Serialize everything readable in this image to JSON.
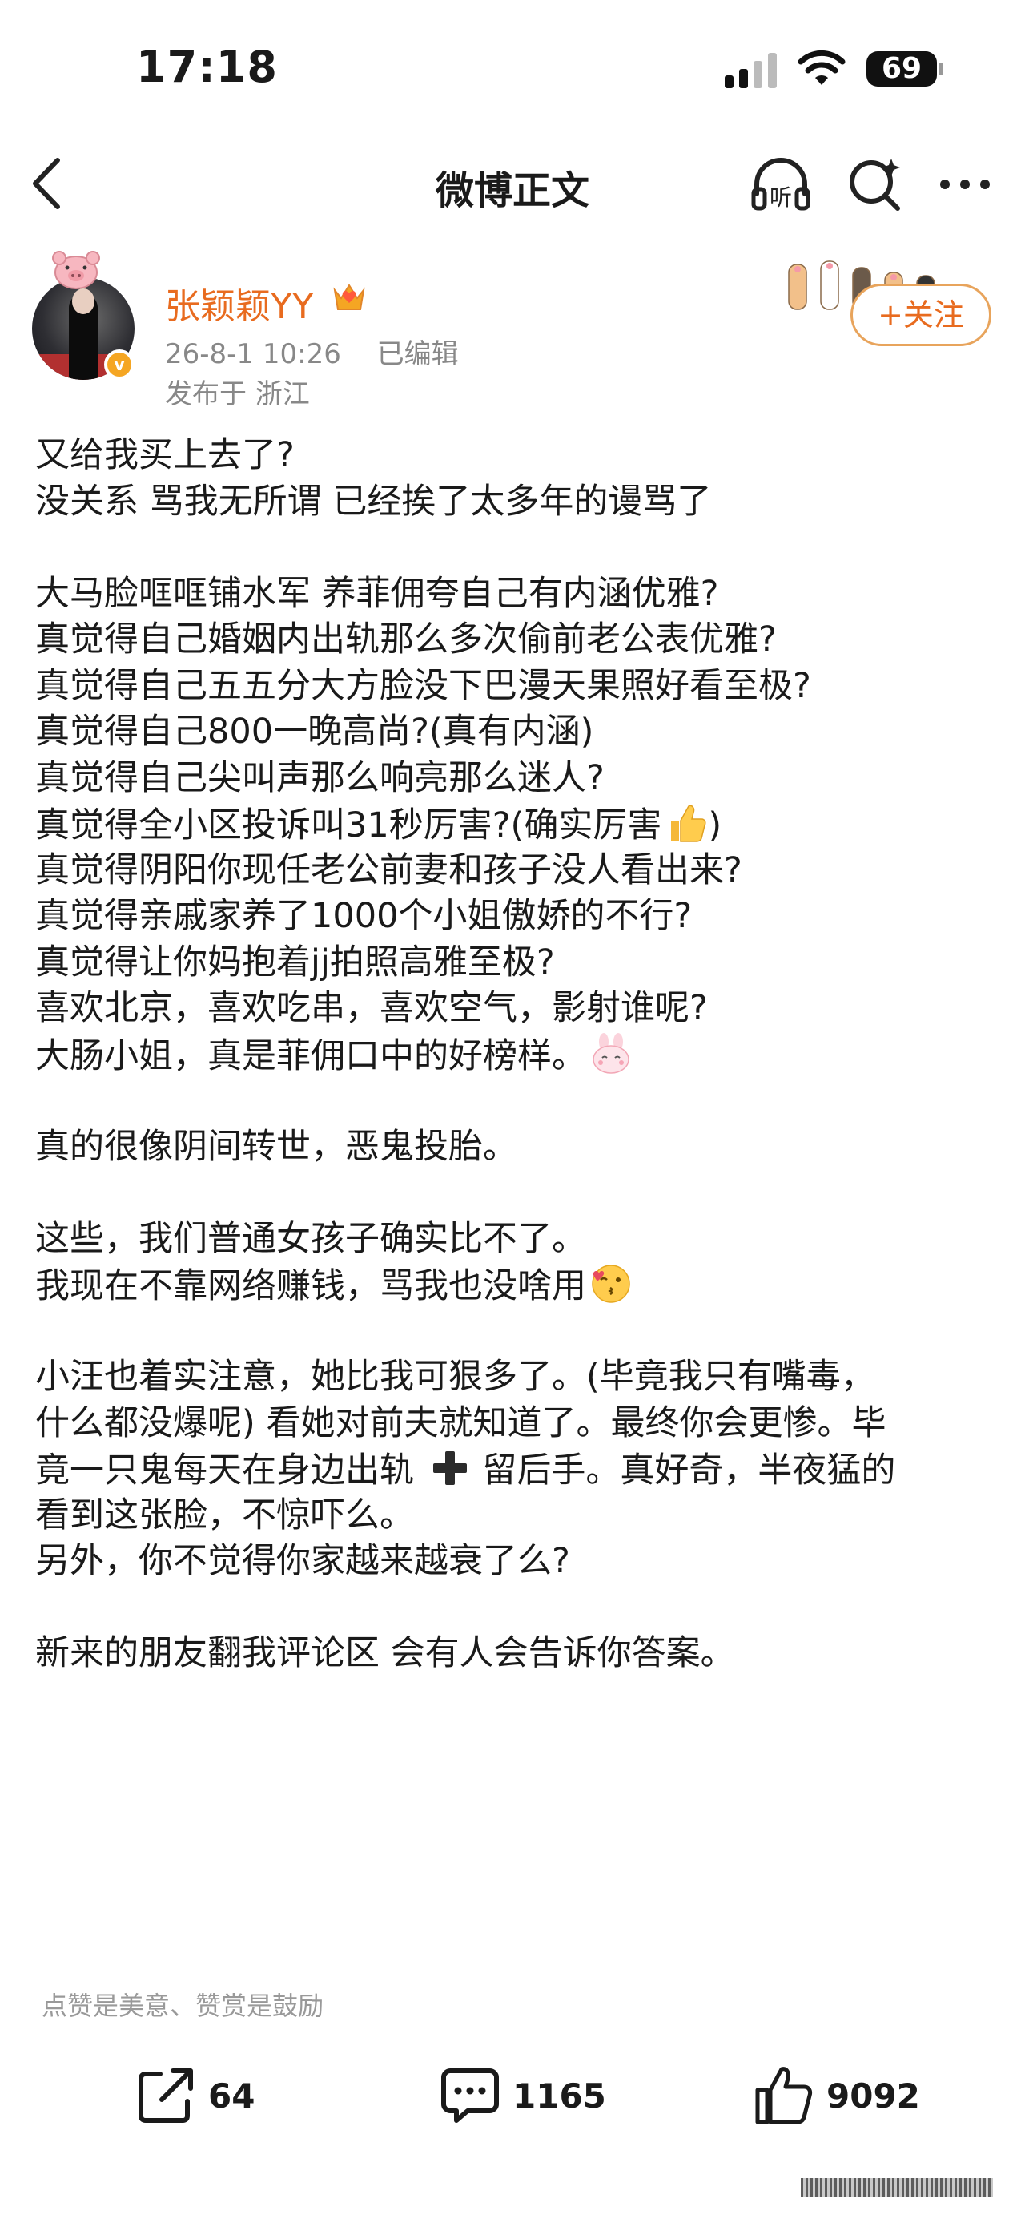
{
  "status_bar": {
    "time": "17:18",
    "battery": "69"
  },
  "nav": {
    "title": "微博正文",
    "back_icon": "chevron-left-icon",
    "listen_icon": "headphones-listen-icon",
    "search_icon": "search-icon",
    "more_icon": "more-dots-icon",
    "listen_label": "听"
  },
  "author": {
    "name": "张颖颖YY",
    "date": "26-8-1 10:26",
    "edited": "已编辑",
    "location": "发布于 浙江",
    "follow_label": "+关注",
    "verified_color": "#f5a623",
    "name_color": "#e86b1f"
  },
  "post": {
    "lines": [
      "又给我买上去了?",
      "没关系 骂我无所谓 已经挨了太多年的谩骂了",
      "",
      "大马脸哐哐铺水军 养菲佣夸自己有内涵优雅?",
      "真觉得自己婚姻内出轨那么多次偷前老公表优雅?",
      "真觉得自己五五分大方脸没下巴漫天果照好看至极?",
      "真觉得自己800一晚高尚?(真有内涵)",
      "真觉得自己尖叫声那么响亮那么迷人?",
      "真觉得全小区投诉叫31秒厉害?(确实厉害",
      "真觉得阴阳你现任老公前妻和孩子没人看出来?",
      "真觉得亲戚家养了1000个小姐傲娇的不行?",
      "真觉得让你妈抱着jj拍照高雅至极?",
      "喜欢北京，喜欢吃串，喜欢空气，影射谁呢?",
      "大肠小姐，真是菲佣口中的好榜样。",
      "",
      "真的很像阴间转世，恶鬼投胎。",
      "",
      "这些，我们普通女孩子确实比不了。",
      "我现在不靠网络赚钱，骂我也没啥用",
      "",
      "小汪也着实注意，她比我可狠多了。(毕竟我只有嘴毒，",
      "什么都没爆呢) 看她对前夫就知道了。最终你会更惨。毕",
      "竟一只鬼每天在身边出轨",
      "看到这张脸，不惊吓么。",
      "另外，你不觉得你家越来越衰了么?",
      "",
      "新来的朋友翻我评论区 会有人会告诉你答案。"
    ],
    "line8_suffix": ")",
    "line22_suffix": "留后手。真好奇，半夜猛的",
    "emojis": {
      "thumbs_up": "thumbs-up-emoji",
      "bunny": "bunny-emoji",
      "kiss": "kiss-face-emoji",
      "plus": "heavy-plus-emoji"
    }
  },
  "footer": {
    "reward_note": "点赞是美意、赞赏是鼓励",
    "repost_count": "64",
    "comment_count": "1165",
    "like_count": "9092",
    "repost_icon": "share-icon",
    "comment_icon": "comment-icon",
    "like_icon": "thumbs-up-icon"
  }
}
